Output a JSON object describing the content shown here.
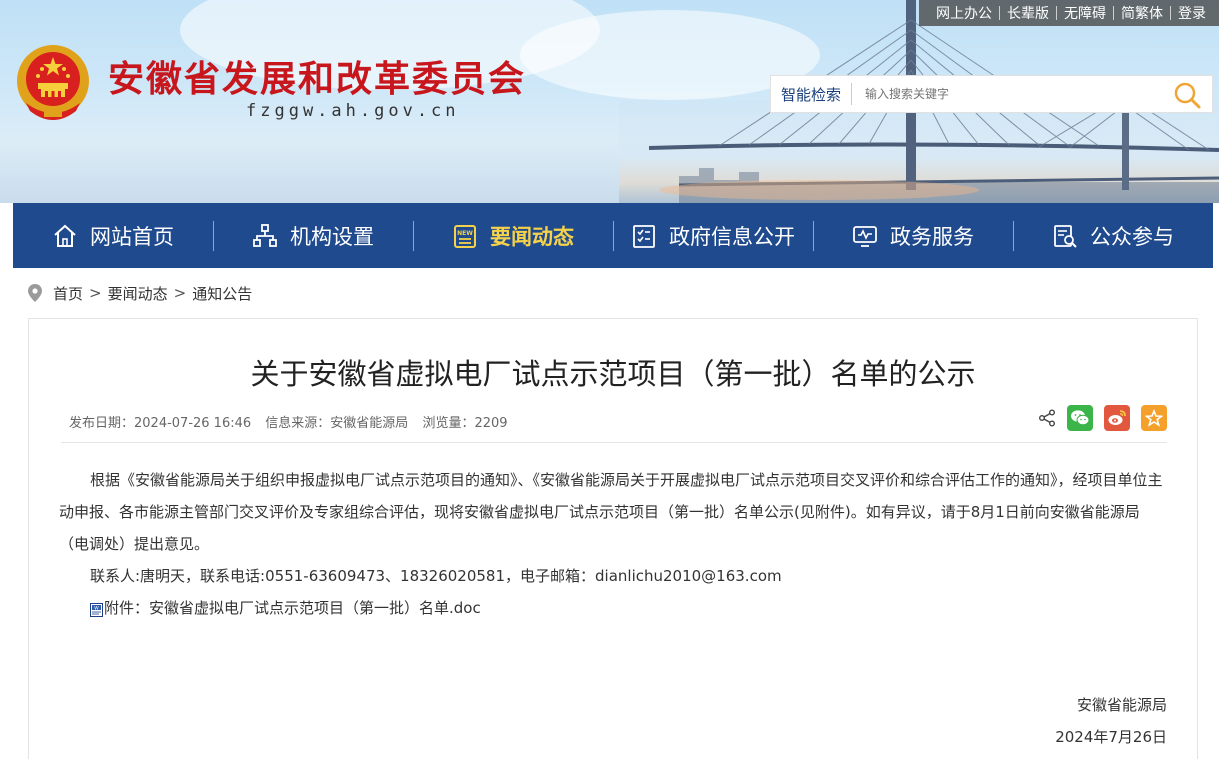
{
  "site": {
    "title": "安徽省发展和改革委员会",
    "domain": "fzggw.ah.gov.cn"
  },
  "topbar": {
    "links": [
      "网上办公",
      "长辈版",
      "无障碍",
      "简繁体",
      "登录"
    ]
  },
  "search": {
    "label": "智能检索",
    "placeholder": "输入搜索关键字"
  },
  "nav": {
    "items": [
      {
        "label": "网站首页",
        "icon": "home-icon"
      },
      {
        "label": "机构设置",
        "icon": "org-chart-icon"
      },
      {
        "label": "要闻动态",
        "icon": "news-icon"
      },
      {
        "label": "政府信息公开",
        "icon": "document-icon"
      },
      {
        "label": "政务服务",
        "icon": "monitor-icon"
      },
      {
        "label": "公众参与",
        "icon": "search-document-icon"
      }
    ],
    "active_index": 2,
    "active_color": "#f5d24a",
    "background": "#1f4a8e"
  },
  "breadcrumb": {
    "items": [
      "首页",
      "要闻动态",
      "通知公告"
    ],
    "separator": ">"
  },
  "article": {
    "title": "关于安徽省虚拟电厂试点示范项目（第一批）名单的公示",
    "meta": {
      "date": "发布日期：2024-07-26 16:46",
      "source": "信息来源：安徽省能源局",
      "views": "浏览量：2209"
    },
    "share_icons": [
      "share-icon",
      "wechat-icon",
      "weibo-icon",
      "favorite-icon"
    ],
    "paragraph1": "根据《安徽省能源局关于组织申报虚拟电厂试点示范项目的通知》、《安徽省能源局关于开展虚拟电厂试点示范项目交叉评价和综合评估工作的通知》，经项目单位主动申报、各市能源主管部门交叉评价及专家组综合评估，现将安徽省虚拟电厂试点示范项目（第一批）名单公示(见附件)。如有异议，请于8月1日前向安徽省能源局（电调处）提出意见。",
    "contact": "联系人:唐明天，联系电话:0551-63609473、18326020581，电子邮箱：dianlichu2010@163.com",
    "attachment": "附件：安徽省虚拟电厂试点示范项目（第一批）名单.doc",
    "sign_org": "安徽省能源局",
    "sign_date": "2024年7月26日"
  }
}
